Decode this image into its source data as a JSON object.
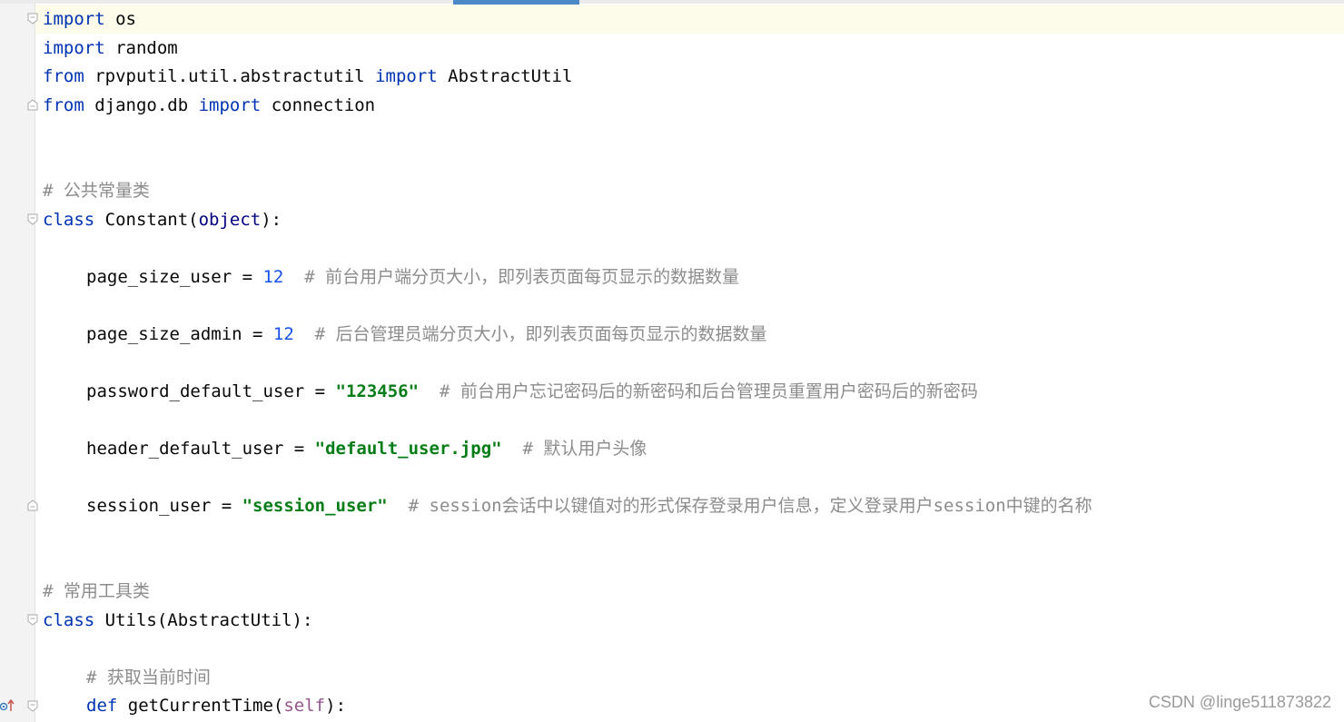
{
  "code": {
    "l1": {
      "kw": "import",
      "rest": " os"
    },
    "l2": {
      "kw": "import",
      "rest": " random"
    },
    "l3": {
      "kw1": "from",
      "mod": " rpvputil.util.abstractutil ",
      "kw2": "import",
      "rest": " AbstractUtil"
    },
    "l4": {
      "kw1": "from",
      "mod": " django.db ",
      "kw2": "import",
      "rest": " connection"
    },
    "c1": "# 公共常量类",
    "l5": {
      "kw": "class",
      "name": " Constant(",
      "base": "object",
      "end": "):"
    },
    "l6": {
      "name": "page_size_user = ",
      "num": "12",
      "cmt": "  # 前台用户端分页大小，即列表页面每页显示的数据数量"
    },
    "l7": {
      "name": "page_size_admin = ",
      "num": "12",
      "cmt": "  # 后台管理员端分页大小，即列表页面每页显示的数据数量"
    },
    "l8": {
      "name": "password_default_user = ",
      "str": "\"123456\"",
      "cmt": "  # 前台用户忘记密码后的新密码和后台管理员重置用户密码后的新密码"
    },
    "l9": {
      "name": "header_default_user = ",
      "str": "\"default_user.jpg\"",
      "cmt": "  # 默认用户头像"
    },
    "l10": {
      "name": "session_user = ",
      "str": "\"session_user\"",
      "cmt": "  # session会话中以键值对的形式保存登录用户信息，定义登录用户session中键的名称"
    },
    "c2": "# 常用工具类",
    "l11": {
      "kw": "class",
      "name": " Utils(AbstractUtil):"
    },
    "c3": "# 获取当前时间",
    "l12": {
      "kw": "def",
      "name": " getCurrentTime(",
      "self": "self",
      "end": "):"
    }
  },
  "watermark": "CSDN @linge511873822",
  "icons": {
    "fold": "fold-marker-icon",
    "override": "override-method-icon"
  },
  "colors": {
    "keyword": "#0033b3",
    "number": "#1750eb",
    "string": "#067d17",
    "comment": "#8c8c8c",
    "self": "#94558d",
    "scroll_indicator": "#4a88c7"
  }
}
